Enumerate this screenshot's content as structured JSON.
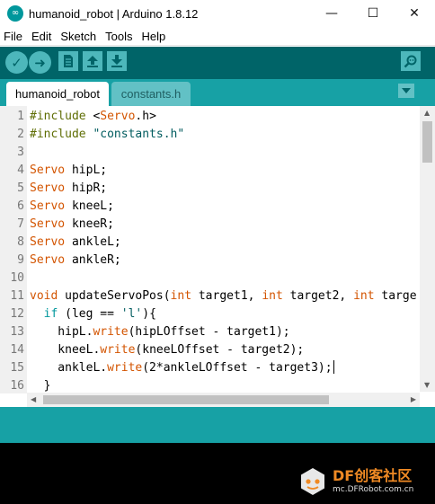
{
  "window": {
    "title": "humanoid_robot | Arduino 1.8.12",
    "logo_glyph": "∞",
    "controls": {
      "minimize": "—",
      "maximize": "☐",
      "close": "✕"
    }
  },
  "menu": [
    "File",
    "Edit",
    "Sketch",
    "Tools",
    "Help"
  ],
  "toolbar": {
    "verify_icon": "check-icon",
    "upload_icon": "arrow-right-icon",
    "new_icon": "file-icon",
    "open_icon": "arrow-up-icon",
    "save_icon": "arrow-down-icon",
    "serial_monitor_icon": "magnifier-icon",
    "verify_glyph": "✓",
    "upload_glyph": "➜"
  },
  "tabs": [
    {
      "label": "humanoid_robot",
      "active": true
    },
    {
      "label": "constants.h",
      "active": false
    }
  ],
  "editor": {
    "lines": [
      {
        "n": "1",
        "text": "#include <Servo.h>"
      },
      {
        "n": "2",
        "text": "#include \"constants.h\""
      },
      {
        "n": "3",
        "text": ""
      },
      {
        "n": "4",
        "text": "Servo hipL;"
      },
      {
        "n": "5",
        "text": "Servo hipR;"
      },
      {
        "n": "6",
        "text": "Servo kneeL;"
      },
      {
        "n": "7",
        "text": "Servo kneeR;"
      },
      {
        "n": "8",
        "text": "Servo ankleL;"
      },
      {
        "n": "9",
        "text": "Servo ankleR;"
      },
      {
        "n": "10",
        "text": ""
      },
      {
        "n": "11",
        "text": "void updateServoPos(int target1, int target2, int targe"
      },
      {
        "n": "12",
        "text": "  if (leg == 'l'){"
      },
      {
        "n": "13",
        "text": "    hipL.write(hipLOffset - target1);"
      },
      {
        "n": "14",
        "text": "    kneeL.write(kneeLOffset - target2);"
      },
      {
        "n": "15",
        "text": "    ankleL.write(2*ankleLOffset - target3);"
      },
      {
        "n": "16",
        "text": "  }"
      }
    ]
  },
  "watermark": {
    "main": "DF创客社区",
    "sub": "mc.DFRobot.com.cn"
  },
  "colors": {
    "toolbar_bg": "#006468",
    "tabbar_bg": "#17a1a5",
    "button_fill": "#4db7bb",
    "keyword": "#00979c",
    "type": "#d35400",
    "preprocessor": "#5e6d03",
    "string": "#005c5f"
  }
}
